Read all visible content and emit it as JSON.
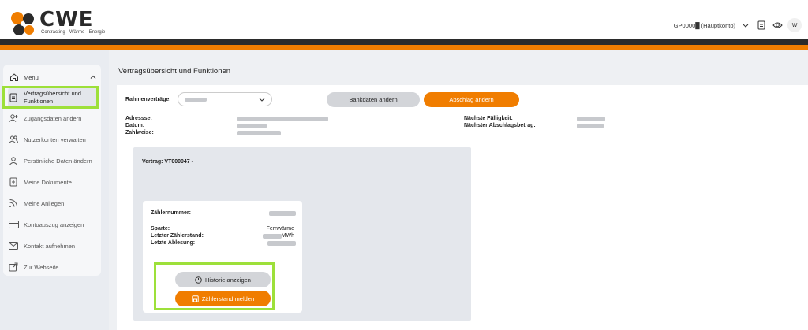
{
  "brand": {
    "name": "CWE",
    "tagline": "Contracting · Wärme · Energie",
    "colors": {
      "orange": "#f07d00",
      "dark": "#2b2b2b",
      "highlight": "#9de03a"
    }
  },
  "header": {
    "account": "GP0000█ (Hauptkonto)",
    "avatar_initial": "W"
  },
  "sidebar": {
    "menu_label": "Menü",
    "items": [
      {
        "label_line1": "Vertragsübersicht und",
        "label_line2": "Funktionen",
        "icon": "document-icon"
      },
      {
        "label": "Zugangsdaten ändern",
        "icon": "user-plus-icon"
      },
      {
        "label": "Nutzerkonten verwalten",
        "icon": "users-icon"
      },
      {
        "label": "Persönliche Daten ändern",
        "icon": "user-icon"
      },
      {
        "label": "Meine Dokumente",
        "icon": "file-icon"
      },
      {
        "label": "Meine Anliegen",
        "icon": "rss-icon"
      },
      {
        "label": "Kontoauszug anzeigen",
        "icon": "card-icon"
      },
      {
        "label": "Kontakt aufnehmen",
        "icon": "mail-icon"
      },
      {
        "label": "Zur Webseite",
        "icon": "external-link-icon"
      }
    ]
  },
  "main": {
    "title": "Vertragsübersicht und Funktionen",
    "frame_contracts_label": "Rahmenverträge:",
    "bank_button": "Bankdaten ändern",
    "installment_button": "Abschlag ändern",
    "address_label": "Adressse:",
    "date_label": "Datum:",
    "payment_label": "Zahlweise:",
    "due_label": "Nächste Fälligkeit:",
    "next_amount_label": "Nächster Abschlagsbetrag:",
    "contract_title": "Vertrag: VT000047 -",
    "meter": {
      "number_label": "Zählernummer:",
      "branch_label": "Sparte:",
      "branch_value": "Fernwärme",
      "last_reading_label": "Letzter Zählerstand:",
      "last_reading_unit": "MWh",
      "last_read_date_label": "Letzte Ablesung:"
    },
    "history_button": "Historie anzeigen",
    "report_button": "Zählerstand melden"
  }
}
